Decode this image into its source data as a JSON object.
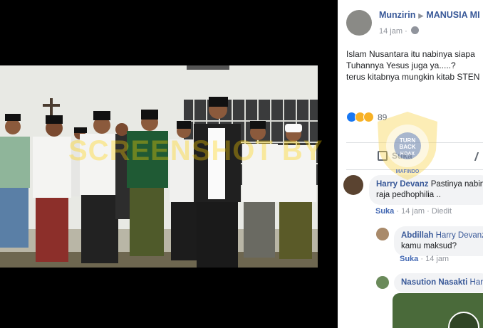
{
  "post": {
    "author": "Munzirin",
    "group": "MANUSIA MI",
    "time": "14 jam",
    "text_lines": [
      "Islam Nusantara itu nabinya siapa",
      "Tuhannya Yesus juga ya.....?",
      "terus kitabnya mungkin kitab STEN"
    ],
    "reaction_count": "89",
    "like_label": "Suka"
  },
  "comments": [
    {
      "name": "Harry Devanz",
      "text_1": "Pastinya nabin",
      "text_2": "raja pedhophilia ..",
      "like": "Suka",
      "time": "14 jam",
      "edited": "Diedit"
    },
    {
      "name": "Abdillah",
      "tag": "Harry Devanz",
      "text_2": "kamu maksud?",
      "like": "Suka",
      "time": "14 jam"
    },
    {
      "name": "Nasution Nasakti",
      "tag": "Har"
    }
  ],
  "watermark": {
    "text": "SCREENSHOT BY",
    "badge_1": "TURN",
    "badge_2": "BACK",
    "badge_3": "HOAX",
    "badge_ring": "MASYARAKAT ANTI FITNAH INDONESIA",
    "badge_bottom": "MAFINDO"
  },
  "colors": {
    "link": "#385898",
    "meta": "#90949c",
    "badge": "#f5c400"
  }
}
